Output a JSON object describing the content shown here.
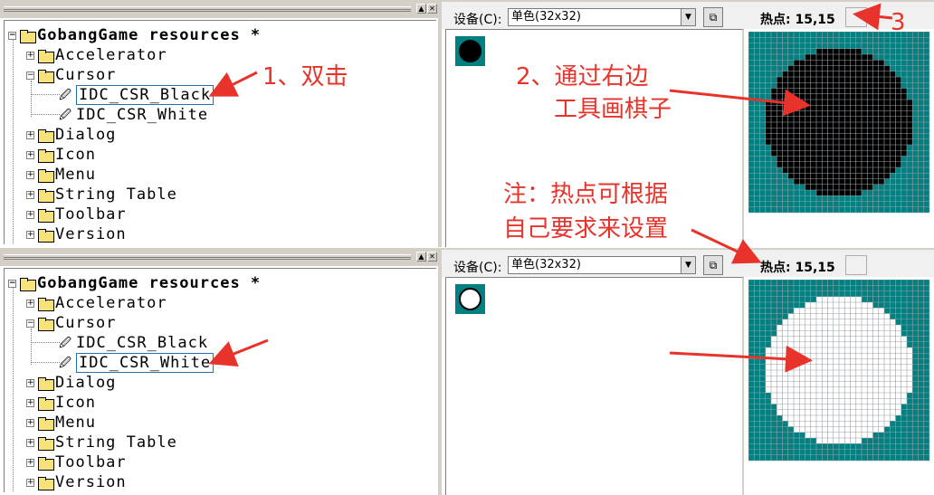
{
  "panes": [
    {
      "id": "top",
      "tree": {
        "root": "GobangGame resources *",
        "items": [
          "Accelerator",
          "Cursor",
          "IDC_CSR_Black",
          "IDC_CSR_White",
          "Dialog",
          "Icon",
          "Menu",
          "String Table",
          "Toolbar",
          "Version"
        ],
        "selected": "IDC_CSR_Black"
      },
      "toolbar": {
        "device_label": "设备(C):",
        "device_value": "单色(32x32)",
        "hotspot_label": "热点:  15,15"
      },
      "cursor_color": "#000000",
      "cursor_outline": "#000000"
    },
    {
      "id": "bottom",
      "tree": {
        "root": "GobangGame resources *",
        "items": [
          "Accelerator",
          "Cursor",
          "IDC_CSR_Black",
          "IDC_CSR_White",
          "Dialog",
          "Icon",
          "Menu",
          "String Table",
          "Toolbar",
          "Version"
        ],
        "selected": "IDC_CSR_White"
      },
      "toolbar": {
        "device_label": "设备(C):",
        "device_value": "单色(32x32)",
        "hotspot_label": "热点:  15,15"
      },
      "cursor_color": "#ffffff",
      "cursor_outline": "#000000"
    }
  ],
  "annotations": {
    "step1": "1、双击",
    "step2_line1": "2、通过右边",
    "step2_line2": "工具画棋子",
    "note_line1": "注：热点可根据",
    "note_line2": "自己要求来设置",
    "step3": "3"
  },
  "colors": {
    "teal": "#008080",
    "annotation_red": "#e8332a",
    "selection_border": "#2b6fb3"
  }
}
